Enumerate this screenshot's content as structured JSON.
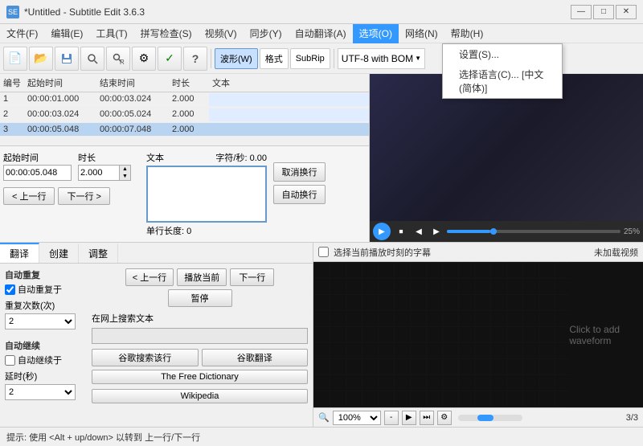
{
  "app": {
    "title": "*Untitled - Subtitle Edit 3.6.3",
    "icon": "SE"
  },
  "titleControls": {
    "minimize": "—",
    "maximize": "□",
    "close": "✕"
  },
  "menuBar": {
    "items": [
      {
        "label": "文件(F)",
        "id": "file"
      },
      {
        "label": "编辑(E)",
        "id": "edit"
      },
      {
        "label": "工具(T)",
        "id": "tools"
      },
      {
        "label": "拼写检查(S)",
        "id": "spell"
      },
      {
        "label": "视频(V)",
        "id": "video"
      },
      {
        "label": "同步(Y)",
        "id": "sync"
      },
      {
        "label": "自动翻译(A)",
        "id": "autotrans"
      },
      {
        "label": "选项(O)",
        "id": "options",
        "active": true
      },
      {
        "label": "网络(N)",
        "id": "network"
      },
      {
        "label": "帮助(H)",
        "id": "help"
      }
    ]
  },
  "dropdown": {
    "items": [
      {
        "label": "设置(S)...",
        "id": "settings"
      },
      {
        "label": "选择语言(C)... [中文(简体)]",
        "id": "language"
      }
    ]
  },
  "toolbar": {
    "buttons": [
      {
        "icon": "📄",
        "label": "new",
        "name": "new-btn"
      },
      {
        "icon": "📂",
        "label": "open",
        "name": "open-btn"
      },
      {
        "icon": "💾",
        "label": "save",
        "name": "save-btn"
      },
      {
        "icon": "🔍",
        "label": "find",
        "name": "find-btn"
      },
      {
        "icon": "🔍",
        "label": "find-replace",
        "name": "find-replace-btn"
      },
      {
        "icon": "⚙",
        "label": "settings",
        "name": "settings-btn"
      },
      {
        "icon": "✓",
        "label": "check",
        "name": "check-btn"
      },
      {
        "icon": "?",
        "label": "help",
        "name": "help-btn"
      }
    ],
    "tabs": [
      "波形(W)",
      "格式",
      "SubRip"
    ],
    "activeTab": "波形(W)",
    "dropdown": "UTF-8 with BOM"
  },
  "table": {
    "headers": [
      "编号",
      "起始时间",
      "结束时间",
      "时长",
      "文本"
    ],
    "rows": [
      {
        "num": "1",
        "start": "00:00:01.000",
        "end": "00:00:03.024",
        "duration": "2.000",
        "text": "",
        "selected": false
      },
      {
        "num": "2",
        "start": "00:00:03.024",
        "end": "00:00:05.024",
        "duration": "2.000",
        "text": "",
        "selected": false
      },
      {
        "num": "3",
        "start": "00:00:05.048",
        "end": "00:00:07.048",
        "duration": "2.000",
        "text": "",
        "selected": true
      }
    ]
  },
  "editArea": {
    "startTimeLabel": "起始时间",
    "durationLabel": "时长",
    "startTimeValue": "00:00:05.048",
    "durationValue": "2.000",
    "prevBtn": "< 上一行",
    "nextBtn": "下一行 >",
    "textLabel": "文本",
    "charRateLabel": "字符/秒: 0.00",
    "singleLineLabel": "单行长度: 0",
    "cancelWrapBtn": "取消换行",
    "autoWrapBtn": "自动换行"
  },
  "panelTabs": [
    "翻译",
    "创建",
    "调整"
  ],
  "translationPanel": {
    "autoRepeat": "自动重复",
    "autoRepeatSub": "✓ 自动重复于",
    "repeatCountLabel": "重复次数(次)",
    "repeatCountValue": "2",
    "autoContinue": "自动继续",
    "autoContinueSub": "□ 自动继续于",
    "delayLabel": "延时(秒)",
    "delayValue": "2",
    "buttons": {
      "prevLine": "< 上一行",
      "playThis": "播放当前",
      "nextLine": "下一行",
      "pause": "暂停",
      "searchOnline": "在网上搜索文本",
      "googleSearch": "谷歌搜索该行",
      "googleTranslate": "谷歌翻译",
      "freeDictionary": "The Free Dictionary",
      "wikipedia": "Wikipedia"
    }
  },
  "wavePanel": {
    "selectSubCheckbox": "选择当前播放时刻的字幕",
    "noVideoLabel": "未加载视频",
    "waveformText": "Click to add waveform",
    "zoomValue": "100%",
    "counter": "3/3"
  },
  "statusBar": {
    "hint": "提示: 使用 <Alt + up/down> 以转到 上一行/下一行"
  }
}
